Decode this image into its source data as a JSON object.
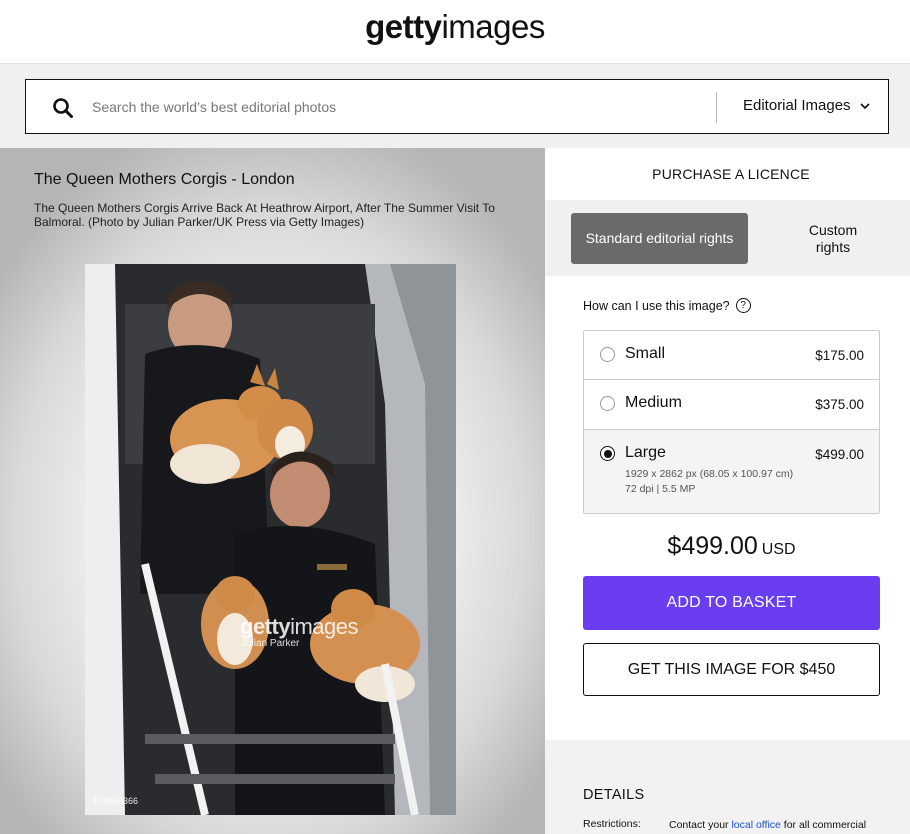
{
  "header": {
    "logo_bold": "getty",
    "logo_light": "images"
  },
  "search": {
    "placeholder": "Search the world’s best editorial photos",
    "value": "",
    "category": "Editorial Images"
  },
  "image": {
    "title": "The Queen Mothers Corgis - London",
    "caption": "The Queen Mothers Corgis Arrive Back At Heathrow Airport, After The Summer Visit To Balmoral. (Photo by Julian Parker/UK Press via Getty Images)",
    "watermark_bold": "getty",
    "watermark_light": "images",
    "watermark_credit": "Julian Parker",
    "id": "158066366"
  },
  "purchase": {
    "title": "PURCHASE A LICENCE",
    "rights": [
      {
        "label": "Standard editorial rights",
        "active": true
      },
      {
        "label": "Custom rights",
        "active": false
      }
    ],
    "question": "How can I use this image?",
    "sizes": [
      {
        "name": "Small",
        "price": "$175.00",
        "selected": false
      },
      {
        "name": "Medium",
        "price": "$375.00",
        "selected": false
      },
      {
        "name": "Large",
        "price": "$499.00",
        "selected": true,
        "detail_line1": "1929 x 2862 px (68.05 x 100.97 cm)",
        "detail_line2": "72 dpi | 5.5 MP"
      }
    ],
    "total_amount": "$499.00",
    "total_currency": "USD",
    "add_button": "ADD TO BASKET",
    "get_button": "GET THIS IMAGE FOR $450"
  },
  "details": {
    "title": "DETAILS",
    "restrictions_label": "Restrictions:",
    "restrictions_text_before": "Contact your",
    "restrictions_link": "local office",
    "restrictions_text_after": "for all commercial"
  },
  "colors": {
    "accent": "#6a3df0",
    "active_tab": "#6a6a6a",
    "band": "#f0f0f0",
    "link": "#1a4fd6"
  }
}
